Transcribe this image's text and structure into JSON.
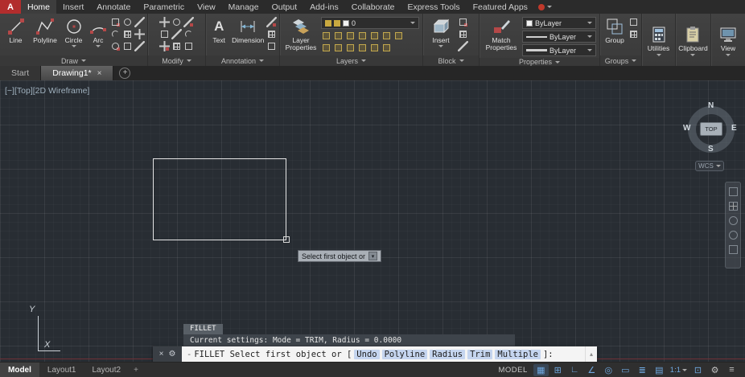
{
  "app": {
    "logo_letter": "A"
  },
  "glyphs": {
    "chevron_down": "▾",
    "chevron_up": "▴",
    "close": "×",
    "plus": "+",
    "customize": "⚙",
    "text_tool": "A"
  },
  "ribbon": {
    "tabs": [
      "Home",
      "Insert",
      "Annotate",
      "Parametric",
      "View",
      "Manage",
      "Output",
      "Add-ins",
      "Collaborate",
      "Express Tools",
      "Featured Apps"
    ],
    "draw": {
      "label": "Draw",
      "line": "Line",
      "polyline": "Polyline",
      "circle": "Circle",
      "arc": "Arc"
    },
    "modify": {
      "label": "Modify"
    },
    "annotation": {
      "label": "Annotation",
      "text": "Text",
      "dimension": "Dimension"
    },
    "layers": {
      "label": "Layers",
      "layer_properties": "Layer Properties",
      "current_layer": "0"
    },
    "block": {
      "label": "Block",
      "insert": "Insert"
    },
    "properties": {
      "label": "Properties",
      "match_properties": "Match Properties",
      "color": "ByLayer",
      "lineweight": "ByLayer",
      "linetype": "ByLayer"
    },
    "groups": {
      "label": "Groups",
      "group": "Group"
    },
    "utilities_label": "Utilities",
    "clipboard_label": "Clipboard",
    "view_label": "View"
  },
  "file_tabs": {
    "start": "Start",
    "drawing": "Drawing1*"
  },
  "viewport": {
    "controls": "[−][Top][2D Wireframe]",
    "compass": {
      "n": "N",
      "e": "E",
      "s": "S",
      "w": "W",
      "top": "TOP"
    },
    "wcs": "WCS"
  },
  "canvas": {
    "tooltip": "Select first object or"
  },
  "ucs": {
    "x_label": "X",
    "y_label": "Y"
  },
  "command": {
    "tag": "FILLET",
    "settings": "Current settings: Mode = TRIM, Radius = 0.0000",
    "marker": "-",
    "prompt_prefix": "FILLET Select first object or [",
    "options": [
      "Undo",
      "Polyline",
      "Radius",
      "Trim",
      "Multiple"
    ],
    "prompt_suffix": "]:"
  },
  "layout_tabs": {
    "model": "Model",
    "layout1": "Layout1",
    "layout2": "Layout2"
  },
  "status": {
    "model_label": "MODEL",
    "scale": "1:1",
    "icons": [
      "▦",
      "⊞",
      "∟",
      "∠",
      "◎",
      "▭",
      "≣",
      "▤",
      "⊡",
      "⚙",
      "≡"
    ]
  }
}
